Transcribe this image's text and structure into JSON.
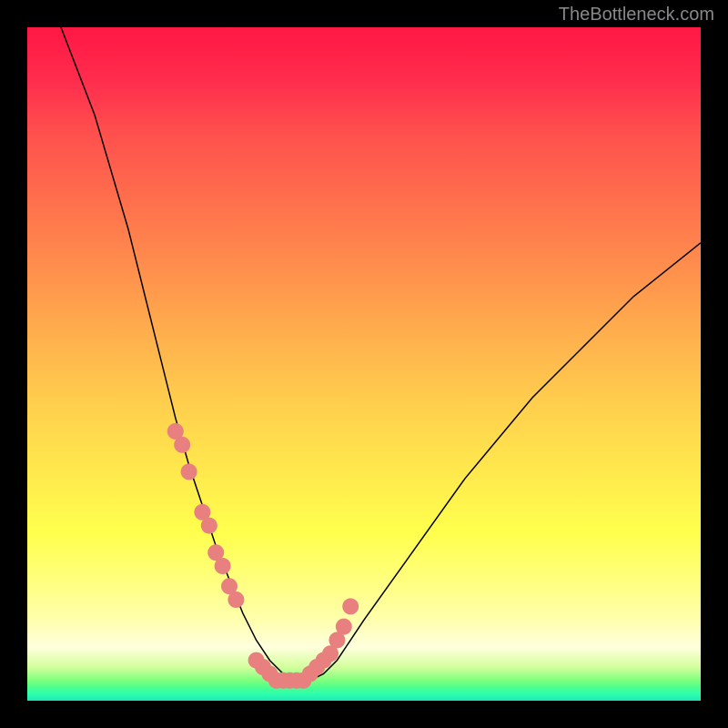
{
  "watermark": "TheBottleneck.com",
  "chart_data": {
    "type": "line",
    "title": "",
    "xlabel": "",
    "ylabel": "",
    "xlim": [
      0,
      100
    ],
    "ylim": [
      0,
      100
    ],
    "description": "Bottleneck percentage curve with V-shape, minimum near x=35-40, over color gradient from red (high bottleneck) to green (low bottleneck)",
    "series": [
      {
        "name": "bottleneck-curve",
        "x": [
          5,
          10,
          15,
          18,
          20,
          22,
          24,
          26,
          28,
          30,
          32,
          34,
          36,
          38,
          40,
          42,
          44,
          46,
          48,
          50,
          55,
          60,
          65,
          70,
          75,
          80,
          85,
          90,
          95,
          100
        ],
        "y": [
          100,
          87,
          70,
          58,
          50,
          42,
          35,
          29,
          23,
          18,
          13,
          9,
          6,
          4,
          3,
          3,
          4,
          6,
          9,
          12,
          19,
          26,
          33,
          39,
          45,
          50,
          55,
          60,
          64,
          68
        ]
      }
    ],
    "markers": {
      "name": "data-points",
      "color": "#e88080",
      "x": [
        22,
        23,
        24,
        26,
        27,
        28,
        29,
        30,
        31,
        34,
        35,
        36,
        37,
        38,
        39,
        40,
        41,
        42,
        43,
        44,
        45,
        46,
        47,
        48
      ],
      "y": [
        40,
        38,
        34,
        28,
        26,
        22,
        20,
        17,
        15,
        6,
        5,
        4,
        3,
        3,
        3,
        3,
        3,
        4,
        5,
        6,
        7,
        9,
        11,
        14
      ]
    },
    "gradient_stops": [
      {
        "pos": 0,
        "color": "#ff1744"
      },
      {
        "pos": 50,
        "color": "#ffcc4d"
      },
      {
        "pos": 75,
        "color": "#ffff4d"
      },
      {
        "pos": 100,
        "color": "#1de9b6"
      }
    ]
  }
}
